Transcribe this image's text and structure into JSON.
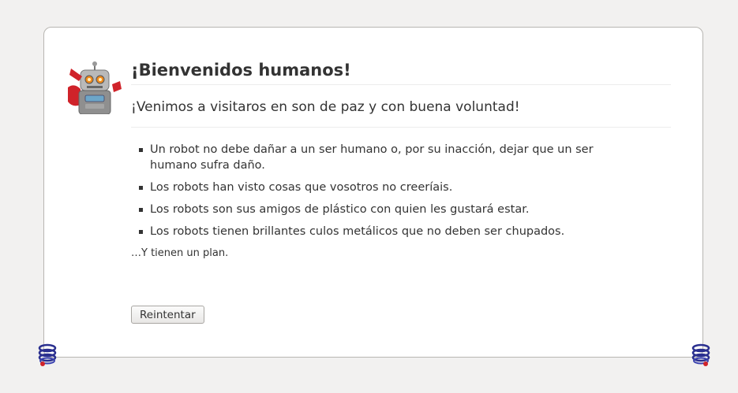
{
  "page": {
    "title": "¡Bienvenidos humanos!",
    "subtitle": "¡Venimos a visitaros en son de paz y con buena voluntad!",
    "laws": [
      "Un robot no debe dañar a un ser humano o, por su inacción, dejar que un ser humano sufra daño.",
      "Los robots han visto cosas que vosotros no creeríais.",
      "Los robots son sus amigos de plástico con quien les gustará estar.",
      "Los robots tienen brillantes culos metálicos que no deben ser chupados."
    ],
    "plan": "…Y tienen un plan.",
    "retry_label": "Reintentar"
  },
  "icons": {
    "robot": "robot-icon",
    "spring": "spring-icon",
    "bullet": "square-bullet"
  },
  "colors": {
    "background": "#f2f1f0",
    "card": "#ffffff",
    "text": "#333333",
    "robot_red": "#d0232a",
    "spring_blue": "#2a2f8f"
  }
}
